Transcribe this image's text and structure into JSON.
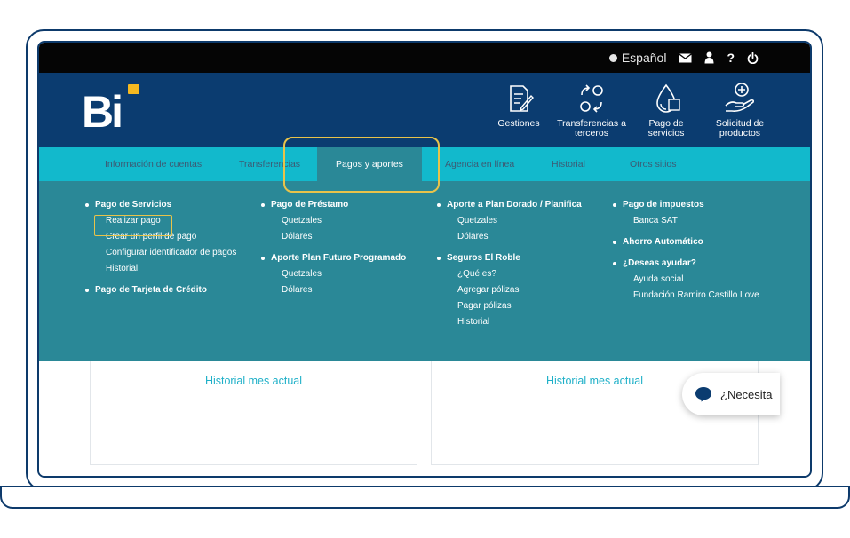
{
  "topbar": {
    "language": "Español",
    "icons": [
      "mail-icon",
      "user-icon",
      "help-icon",
      "power-icon"
    ],
    "help_glyph": "?"
  },
  "brand": {
    "logo_text": "Bi",
    "accent_color": "#f5b921",
    "primary_color": "#0b3c70",
    "nav_color": "#12b9cc",
    "menu_color": "#2a8897"
  },
  "shortcuts": [
    {
      "label_1": "Gestiones",
      "label_2": "",
      "icon": "document-edit-icon"
    },
    {
      "label_1": "Transferencias a",
      "label_2": "terceros",
      "icon": "transfer-icon"
    },
    {
      "label_1": "Pago de",
      "label_2": "servicios",
      "icon": "water-drop-icon"
    },
    {
      "label_1": "Solicitud de",
      "label_2": "productos",
      "icon": "hand-plus-icon"
    }
  ],
  "nav": {
    "items": [
      "Información de cuentas",
      "Transferencias",
      "Pagos y aportes",
      "Agencia en línea",
      "Historial",
      "Otros sitios"
    ],
    "active": "Pagos y aportes"
  },
  "mega_menu": {
    "col1": {
      "g1": "Pago de Servicios",
      "g1_items": [
        "Realizar pago",
        "Crear un perfil de pago",
        "Configurar identificador de pagos",
        "Historial"
      ],
      "g2": "Pago de Tarjeta de Crédito"
    },
    "col2": {
      "g1": "Pago de Préstamo",
      "g1_items": [
        "Quetzales",
        "Dólares"
      ],
      "g2": "Aporte Plan Futuro Programado",
      "g2_items": [
        "Quetzales",
        "Dólares"
      ]
    },
    "col3": {
      "g1": "Aporte a Plan Dorado / Planifica",
      "g1_items": [
        "Quetzales",
        "Dólares"
      ],
      "g2": "Seguros El Roble",
      "g2_items": [
        "¿Qué es?",
        "Agregar pólizas",
        "Pagar pólizas",
        "Historial"
      ]
    },
    "col4": {
      "g1": "Pago de impuestos",
      "g1_items": [
        "Banca SAT"
      ],
      "g2": "Ahorro Automático",
      "g3": "¿Deseas ayudar?",
      "g3_items": [
        "Ayuda social",
        "Fundación Ramiro Castillo Love"
      ]
    }
  },
  "cards": [
    "Historial mes actual",
    "Historial mes actual"
  ],
  "chat": {
    "text": "¿Necesita"
  },
  "highlights": [
    "Pagos y aportes",
    "Realizar pago"
  ]
}
